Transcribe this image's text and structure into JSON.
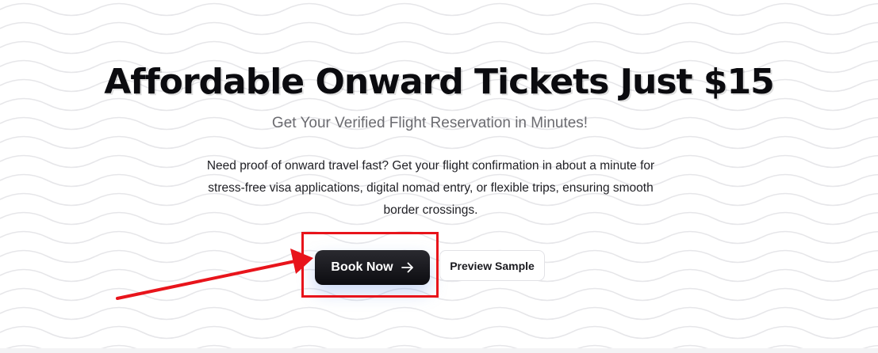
{
  "hero": {
    "title": "Affordable Onward Tickets Just $15",
    "subtitle": "Get Your Verified Flight Reservation in Minutes!",
    "description": "Need proof of onward travel fast? Get your flight confirmation in about a minute for stress-free visa applications, digital nomad entry, or flexible trips, ensuring smooth border crossings."
  },
  "buttons": {
    "book_label": "Book Now",
    "book_icon": "arrow-right-icon",
    "preview_label": "Preview Sample"
  },
  "annotation": {
    "color": "#e8141b"
  },
  "colors": {
    "title": "#0b0b0f",
    "subtitle": "#6b6b70",
    "primary_button": "#111114",
    "background": "#ffffff"
  }
}
